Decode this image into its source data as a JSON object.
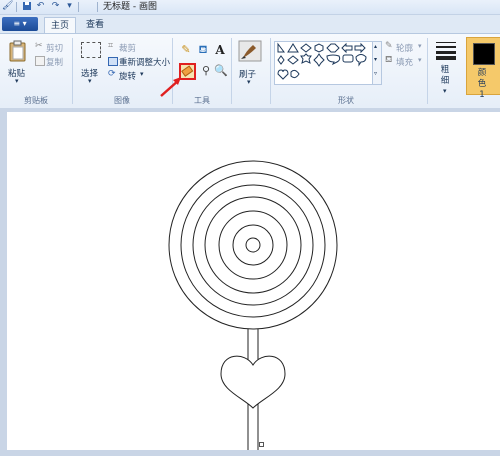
{
  "titlebar": {
    "title": "无标题 - 画图",
    "quick_access": [
      "paint-app-icon",
      "save-icon",
      "undo-icon",
      "redo-icon",
      "customize-quick-access-icon"
    ]
  },
  "tabs": {
    "menu": "≡ ▾",
    "home": "主页",
    "view": "查看"
  },
  "clipboard": {
    "paste": "粘贴",
    "cut": "剪切",
    "copy": "复制",
    "group": "剪贴板"
  },
  "image": {
    "select": "选择",
    "crop": "裁剪",
    "resize": "重新调整大小",
    "rotate": "旋转",
    "group": "图像"
  },
  "tools": {
    "group": "工具",
    "selected": "eraser"
  },
  "brushes": {
    "label": "刷子"
  },
  "shapes": {
    "group": "形状",
    "outline": "轮廓",
    "fill": "填充"
  },
  "size": {
    "label": "粗细"
  },
  "color1": {
    "label": "颜色 1",
    "value": "#000000"
  },
  "colors": {
    "accent": "#1c4b96",
    "highlight": "#e02020",
    "color1_bg": "#f5c96a"
  }
}
